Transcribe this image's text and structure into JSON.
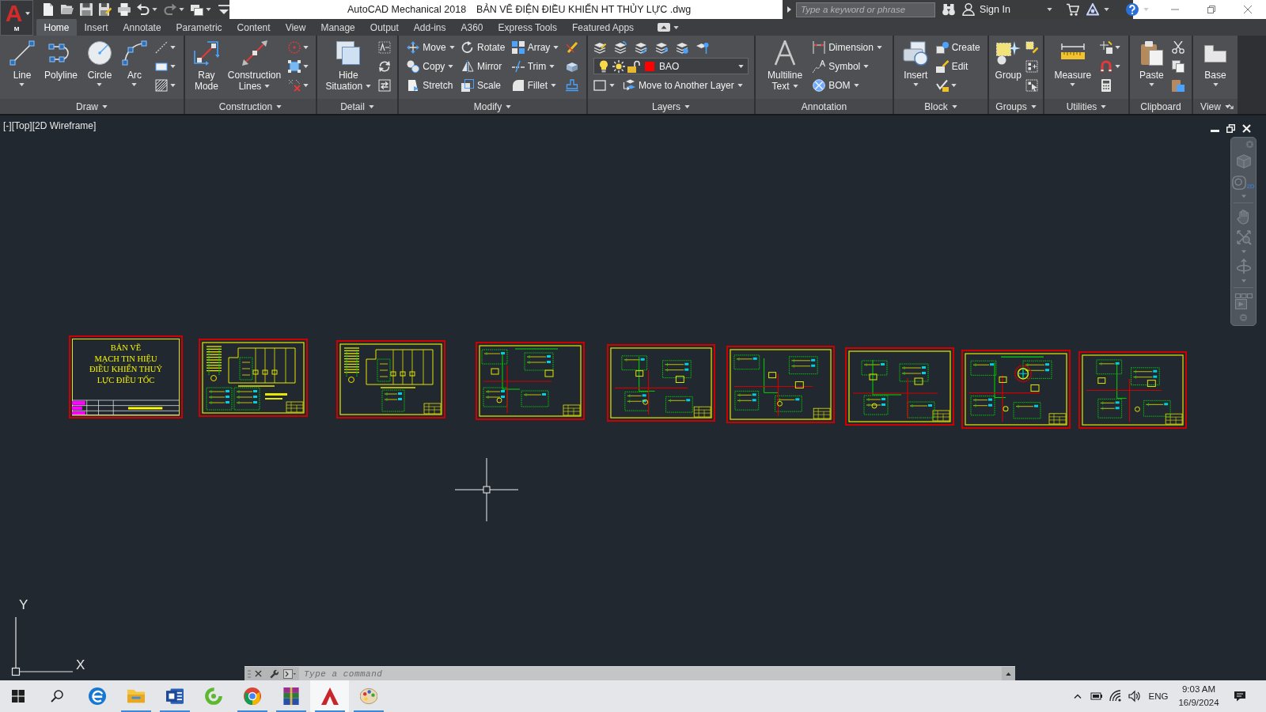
{
  "title_bar": {
    "app_button": {
      "logo": "A",
      "badge": "M"
    },
    "quick_access": [
      {
        "menu": false,
        "disabled": false
      },
      {
        "menu": false,
        "disabled": false
      },
      {
        "menu": false,
        "disabled": false
      },
      {
        "menu": false,
        "disabled": false
      },
      {
        "menu": false,
        "disabled": false
      },
      {
        "menu": true,
        "disabled": false
      },
      {
        "menu": true,
        "disabled": true
      },
      {
        "menu": true,
        "disabled": false
      },
      {
        "menu": false,
        "disabled": false
      }
    ],
    "app_name": "AutoCAD Mechanical 2018",
    "file_name": "BẢN VẼ ĐIỆN ĐIỀU KHIỂN HT THỦY LỰC .dwg",
    "search": {
      "placeholder": "Type a keyword or phrase"
    },
    "sign_in": {
      "label": "Sign In",
      "menu": true
    }
  },
  "tabs": [
    {
      "label": "Home",
      "selected": true
    },
    {
      "label": "Insert",
      "selected": false
    },
    {
      "label": "Annotate",
      "selected": false
    },
    {
      "label": "Parametric",
      "selected": false
    },
    {
      "label": "Content",
      "selected": false
    },
    {
      "label": "View",
      "selected": false
    },
    {
      "label": "Manage",
      "selected": false
    },
    {
      "label": "Output",
      "selected": false
    },
    {
      "label": "Add-ins",
      "selected": false
    },
    {
      "label": "A360",
      "selected": false
    },
    {
      "label": "Express Tools",
      "selected": false
    },
    {
      "label": "Featured Apps",
      "selected": false
    }
  ],
  "ribbon": {
    "panels": [
      {
        "title": "Draw",
        "menu": true,
        "launcher": false,
        "kind": "columns",
        "groups": [
          {
            "kind": "large",
            "lines": [
              "Line"
            ],
            "menu": true
          },
          {
            "kind": "large",
            "lines": [
              "Polyline"
            ],
            "menu": false
          },
          {
            "kind": "large",
            "lines": [
              "Circle"
            ],
            "menu": true
          },
          {
            "kind": "large",
            "lines": [
              "Arc"
            ],
            "menu": true
          },
          {
            "kind": "column",
            "items": [
              {
                "menu": true
              },
              {
                "menu": true
              },
              {
                "menu": true
              }
            ]
          }
        ]
      },
      {
        "title": "Construction",
        "menu": true,
        "launcher": false,
        "kind": "columns",
        "groups": [
          {
            "kind": "large",
            "lines": [
              "Ray",
              "Mode"
            ],
            "menu": false
          },
          {
            "kind": "large",
            "lines": [
              "Construction",
              "Lines"
            ],
            "menu": true
          },
          {
            "kind": "column",
            "items": [
              {
                "menu": true
              },
              {
                "menu": true
              },
              {
                "menu": true
              }
            ]
          }
        ]
      },
      {
        "title": "Detail",
        "menu": true,
        "launcher": false,
        "kind": "columns",
        "groups": [
          {
            "kind": "large",
            "lines": [
              "Hide",
              "Situation"
            ],
            "menu": true
          },
          {
            "kind": "column",
            "items": [
              {
                "menu": false
              },
              {
                "menu": false
              },
              {
                "menu": false
              }
            ]
          }
        ]
      },
      {
        "title": "Modify",
        "menu": true,
        "launcher": false,
        "kind": "columns",
        "groups": [
          {
            "kind": "column",
            "items": [
              {
                "label": "Move",
                "menu": true
              },
              {
                "label": "Copy",
                "menu": true
              },
              {
                "label": "Stretch",
                "menu": false
              }
            ]
          },
          {
            "kind": "column",
            "items": [
              {
                "label": "Rotate",
                "menu": false
              },
              {
                "label": "Mirror",
                "menu": false
              },
              {
                "label": "Scale",
                "menu": false
              }
            ]
          },
          {
            "kind": "column",
            "items": [
              {
                "label": "Array",
                "menu": true
              },
              {
                "label": "Trim",
                "menu": true
              },
              {
                "label": "Fillet",
                "menu": true
              }
            ]
          },
          {
            "kind": "column",
            "items": [
              {
                "menu": false
              },
              {
                "menu": false
              },
              {
                "menu": false
              }
            ]
          }
        ]
      },
      {
        "title": "Layers",
        "menu": true,
        "launcher": false,
        "kind": "rows",
        "groups": [
          {
            "kind": "row",
            "items": [
              {
                "menu": false
              },
              {
                "menu": false
              },
              {
                "menu": false
              },
              {
                "menu": false
              },
              {
                "menu": false
              },
              {
                "menu": false
              }
            ]
          },
          {
            "kind": "layer",
            "layer": {
              "value": "BAO",
              "color": "#ff0000"
            }
          },
          {
            "kind": "row",
            "items": [
              {
                "menu": true
              },
              {
                "label": "Move to Another Layer",
                "menu": true
              }
            ]
          }
        ]
      },
      {
        "title": "Annotation",
        "menu": false,
        "launcher": false,
        "kind": "columns",
        "groups": [
          {
            "kind": "large",
            "lines": [
              "Multiline",
              "Text"
            ],
            "menu": true
          },
          {
            "kind": "column",
            "items": [
              {
                "label": "Dimension",
                "menu": true
              },
              {
                "label": "Symbol",
                "menu": true
              },
              {
                "label": "BOM",
                "menu": true
              }
            ]
          }
        ]
      },
      {
        "title": "Block",
        "menu": true,
        "launcher": false,
        "kind": "columns",
        "groups": [
          {
            "kind": "large",
            "lines": [
              "Insert"
            ],
            "menu": true
          },
          {
            "kind": "column",
            "items": [
              {
                "label": "Create",
                "menu": false
              },
              {
                "label": "Edit",
                "menu": false
              },
              {
                "menu": true
              }
            ]
          }
        ]
      },
      {
        "title": "Groups",
        "menu": true,
        "launcher": false,
        "kind": "columns",
        "groups": [
          {
            "kind": "large",
            "lines": [
              "Group"
            ],
            "menu": false
          },
          {
            "kind": "column",
            "items": [
              {
                "menu": false
              },
              {
                "menu": false
              },
              {
                "menu": false
              }
            ]
          }
        ]
      },
      {
        "title": "Utilities",
        "menu": true,
        "launcher": false,
        "kind": "columns",
        "groups": [
          {
            "kind": "large",
            "lines": [
              "Measure"
            ],
            "menu": true
          },
          {
            "kind": "column",
            "items": [
              {
                "menu": true
              },
              {
                "menu": true
              },
              {
                "menu": false
              }
            ]
          }
        ]
      },
      {
        "title": "Clipboard",
        "menu": false,
        "launcher": false,
        "kind": "columns",
        "groups": [
          {
            "kind": "large",
            "lines": [
              "Paste"
            ],
            "menu": true
          },
          {
            "kind": "column",
            "items": [
              {
                "menu": false
              },
              {
                "menu": false
              },
              {
                "menu": false
              }
            ]
          }
        ]
      },
      {
        "title": "View",
        "menu": true,
        "launcher": true,
        "kind": "columns",
        "groups": [
          {
            "kind": "large",
            "lines": [
              "Base"
            ],
            "menu": true
          }
        ]
      }
    ]
  },
  "viewport": {
    "label": "[-][Top][2D Wireframe]",
    "sheets": [
      {
        "kind": "title",
        "lines": [
          "BẢN VẼ",
          "MẠCH TIN HIỆU",
          "ĐIỀU KHIỂN THUỶ",
          "LỰC ĐIỀU TỐC"
        ]
      },
      {
        "kind": "schematic"
      },
      {
        "kind": "schematic"
      },
      {
        "kind": "schematic"
      },
      {
        "kind": "schematic"
      },
      {
        "kind": "schematic"
      },
      {
        "kind": "schematic"
      },
      {
        "kind": "schematic"
      },
      {
        "kind": "schematic"
      }
    ],
    "nav_bar": {
      "wheel_label": "2D"
    },
    "ucs": {
      "y_label": "Y",
      "x_label": "X"
    }
  },
  "command_line": {
    "placeholder": "Type a command"
  },
  "taskbar": {
    "apps": [
      {
        "running": false,
        "selected": false
      },
      {
        "running": true,
        "selected": false
      },
      {
        "running": true,
        "selected": false
      },
      {
        "running": false,
        "selected": false
      },
      {
        "running": true,
        "selected": false
      },
      {
        "running": true,
        "selected": false
      },
      {
        "running": true,
        "selected": true
      },
      {
        "running": true,
        "selected": false
      }
    ],
    "language": "ENG",
    "time": "9:03 AM",
    "date": "16/9/2024"
  }
}
